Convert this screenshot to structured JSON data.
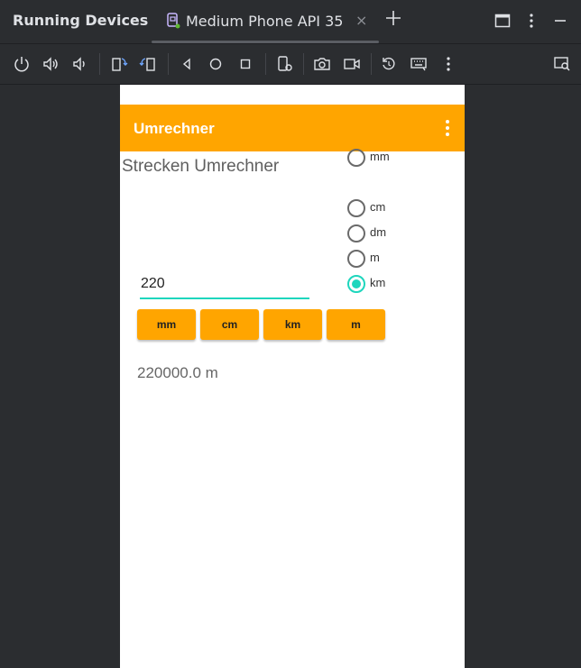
{
  "panel": {
    "title": "Running Devices"
  },
  "tab": {
    "label": "Medium Phone API 35",
    "close": "×"
  },
  "toolbar": {
    "icons": [
      "power-icon",
      "volume-up-icon",
      "volume-down-icon",
      "rotate-left-icon",
      "rotate-right-icon",
      "back-icon",
      "home-icon",
      "overview-icon",
      "device-settings-icon",
      "camera-icon",
      "video-icon",
      "reset-icon",
      "keyboard-icon",
      "more-icon",
      "device-explorer-icon"
    ]
  },
  "app": {
    "title": "Umrechner",
    "heading": "Strecken Umrechner",
    "units": [
      {
        "label": "mm",
        "selected": false
      },
      {
        "label": "cm",
        "selected": false
      },
      {
        "label": "dm",
        "selected": false
      },
      {
        "label": "m",
        "selected": false
      },
      {
        "label": "km",
        "selected": true
      }
    ],
    "input_value": "220",
    "buttons": [
      "mm",
      "cm",
      "km",
      "m"
    ],
    "result": "220000.0 m"
  },
  "colors": {
    "ide_bg": "#2b2d30",
    "app_accent": "#ffa500",
    "radio_accent": "#1ed6bd"
  }
}
